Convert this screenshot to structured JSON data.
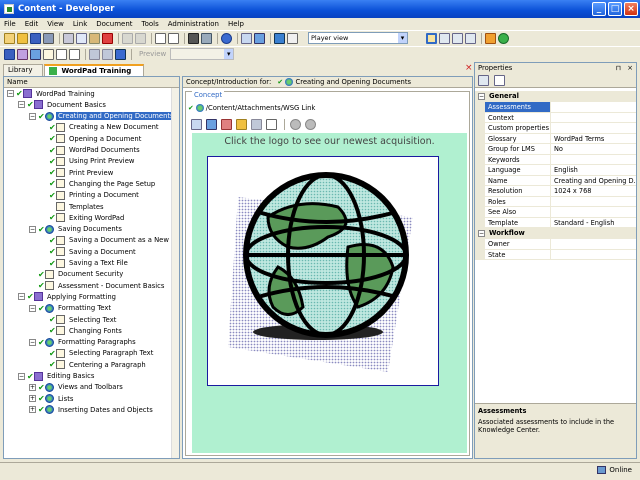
{
  "window": {
    "title": "Content - Developer"
  },
  "menu": [
    "File",
    "Edit",
    "View",
    "Link",
    "Document",
    "Tools",
    "Administration",
    "Help"
  ],
  "toolbar": {
    "player_view": "Player view",
    "preview": "Preview"
  },
  "tabs": [
    {
      "label": "Library"
    },
    {
      "label": "WordPad Training"
    }
  ],
  "tree": {
    "header": "Name",
    "items": [
      {
        "label": "WordPad Training",
        "depth": 0,
        "icon": "book",
        "expand": "−",
        "check": true
      },
      {
        "label": "Document Basics",
        "depth": 1,
        "icon": "book",
        "expand": "−",
        "check": true
      },
      {
        "label": "Creating and Opening Documents",
        "depth": 2,
        "icon": "globe",
        "expand": "−",
        "check": true,
        "selected": true
      },
      {
        "label": "Creating a New Document",
        "depth": 3,
        "icon": "doc",
        "expand": "",
        "check": true
      },
      {
        "label": "Opening a Document",
        "depth": 3,
        "icon": "doc",
        "expand": "",
        "check": true
      },
      {
        "label": "WordPad Documents",
        "depth": 3,
        "icon": "doc",
        "expand": "",
        "check": true
      },
      {
        "label": "Using Print Preview",
        "depth": 3,
        "icon": "doc",
        "expand": "",
        "check": true
      },
      {
        "label": "Print Preview",
        "depth": 3,
        "icon": "doc",
        "expand": "",
        "check": true
      },
      {
        "label": "Changing the Page Setup",
        "depth": 3,
        "icon": "doc",
        "expand": "",
        "check": true
      },
      {
        "label": "Printing a Document",
        "depth": 3,
        "icon": "doc",
        "expand": "",
        "check": true
      },
      {
        "label": "Templates",
        "depth": 3,
        "icon": "doc",
        "expand": "",
        "check": false
      },
      {
        "label": "Exiting WordPad",
        "depth": 3,
        "icon": "doc",
        "expand": "",
        "check": true
      },
      {
        "label": "Saving Documents",
        "depth": 2,
        "icon": "globe",
        "expand": "−",
        "check": true
      },
      {
        "label": "Saving a Document as a New File",
        "depth": 3,
        "icon": "doc",
        "expand": "",
        "check": true
      },
      {
        "label": "Saving a Document",
        "depth": 3,
        "icon": "doc",
        "expand": "",
        "check": true
      },
      {
        "label": "Saving a Text File",
        "depth": 3,
        "icon": "doc",
        "expand": "",
        "check": true
      },
      {
        "label": "Document Security",
        "depth": 2,
        "icon": "doc",
        "expand": "",
        "check": true
      },
      {
        "label": "Assessment - Document Basics",
        "depth": 2,
        "icon": "doc",
        "expand": "",
        "check": true
      },
      {
        "label": "Applying Formatting",
        "depth": 1,
        "icon": "book",
        "expand": "−",
        "check": true
      },
      {
        "label": "Formatting Text",
        "depth": 2,
        "icon": "globe",
        "expand": "−",
        "check": true
      },
      {
        "label": "Selecting Text",
        "depth": 3,
        "icon": "doc",
        "expand": "",
        "check": true
      },
      {
        "label": "Changing Fonts",
        "depth": 3,
        "icon": "doc",
        "expand": "",
        "check": true
      },
      {
        "label": "Formatting Paragraphs",
        "depth": 2,
        "icon": "globe",
        "expand": "−",
        "check": true
      },
      {
        "label": "Selecting Paragraph Text",
        "depth": 3,
        "icon": "doc",
        "expand": "",
        "check": true
      },
      {
        "label": "Centering a Paragraph",
        "depth": 3,
        "icon": "doc",
        "expand": "",
        "check": true
      },
      {
        "label": "Editing Basics",
        "depth": 1,
        "icon": "book",
        "expand": "−",
        "check": true
      },
      {
        "label": "Views and Toolbars",
        "depth": 2,
        "icon": "globe",
        "expand": "+",
        "check": true
      },
      {
        "label": "Lists",
        "depth": 2,
        "icon": "globe",
        "expand": "+",
        "check": true
      },
      {
        "label": "Inserting Dates and Objects",
        "depth": 2,
        "icon": "globe",
        "expand": "+",
        "check": true
      }
    ]
  },
  "center": {
    "header_label": "Concept/Introduction for:",
    "header_title": "Creating and Opening Documents",
    "legend": "Concept",
    "link_path": "/Content/Attachments/WSG Link",
    "promo_text": "Click the logo to see our newest acquisition."
  },
  "properties": {
    "title": "Properties",
    "close": "×",
    "pin": "⊓",
    "categories": [
      {
        "name": "General",
        "rows": [
          {
            "key": "Assessments",
            "value": "",
            "selected": true
          },
          {
            "key": "Context",
            "value": ""
          },
          {
            "key": "Custom properties",
            "value": ""
          },
          {
            "key": "Glossary",
            "value": "WordPad Terms"
          },
          {
            "key": "Group for LMS",
            "value": "No"
          },
          {
            "key": "Keywords",
            "value": ""
          },
          {
            "key": "Language",
            "value": "English"
          },
          {
            "key": "Name",
            "value": "Creating and Opening D..."
          },
          {
            "key": "Resolution",
            "value": "1024 x 768"
          },
          {
            "key": "Roles",
            "value": ""
          },
          {
            "key": "See Also",
            "value": ""
          },
          {
            "key": "Template",
            "value": "Standard - English"
          }
        ]
      },
      {
        "name": "Workflow",
        "rows": [
          {
            "key": "Owner",
            "value": ""
          },
          {
            "key": "State",
            "value": ""
          }
        ]
      }
    ],
    "desc_title": "Assessments",
    "desc_text": "Associated assessments to include in the Knowledge Center."
  },
  "status": {
    "online": "Online"
  },
  "colors": {
    "selection": "#316ac5",
    "concept_bg": "#b0f0d0",
    "check": "#119911"
  }
}
